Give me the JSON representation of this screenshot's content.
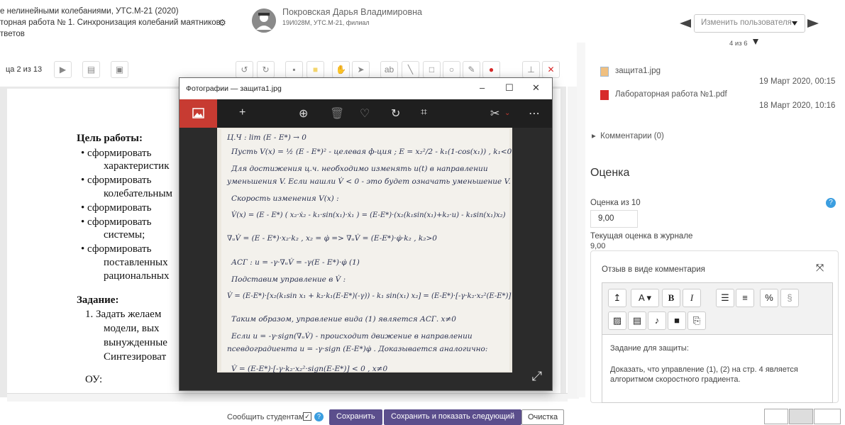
{
  "header": {
    "course_title": "е нелинейными колебаниями, УТС.М-21 (2020)",
    "assignment_title": "торная работа № 1. Синхронизация колебаний маятников",
    "answers_link": "тветов",
    "user_name": "Покровская Дарья Владимировна",
    "user_info": "19И028М, УТС.М-21, филиал",
    "change_user_placeholder": "Изменить пользователя",
    "user_count": "4 из 6"
  },
  "pdf_toolbar": {
    "page_label": "ца 2 из 13"
  },
  "document": {
    "lines": [
      "Цель работы:",
      "•  сформировать",
      "характеристик",
      "•  сформировать",
      "колебательным",
      "•  сформировать",
      "•  сформировать",
      "системы;",
      "•  сформировать",
      "поставленных",
      "рациональных",
      "Задание:",
      "1.  Задать желаем",
      "модели,  вых",
      "вынужденные",
      "Синтезироват",
      "ОУ:"
    ]
  },
  "photo_window": {
    "title": "Фотографии — защита1.jpg",
    "handwriting": [
      "Ц.Ч :  lim (E - E*) → 0",
      "Пусть  V(x) = ½ (E - E*)²  - целевая ф-ция ;  E = x₂²/2 - k₁(1-cos(x₁)) , k₁<0",
      "Для достижения ц.ч. необходимо изменять u(t) в направлении",
      "уменьшения V.  Если нашли V̇ < 0 - это будет означать уменьшение V.",
      "Скорость изменения V(x) :",
      "V̇(x) = (E - E*) ( x₂·ẋ₂ - k₁·sin(x₁)·ẋ₁ ) = (E-E*)·(x₂(k₁sin(x₁)+k₂·u) - k₁sin(x₁)x₂)",
      "∇ᵤV̇ = (E - E*)·x₂·k₂ ,   x₂ = φ̇   =>  ∇ᵤV̇ = (E-E*)·φ̇·k₂ , k₂>0",
      "АСГ :  u = -γ·∇ᵤV̇ = -γ(E - E*)·φ̇          (1)",
      "Подставим управление в V̇ :",
      "V̇ = (E-E*)·[x₂(k₁sin x₁ + k₂·k₁(E-E*)(-γ)) - k₁ sin(x₁) x₂] = (E-E*)·[-γ·k₂·x₂²(E-E*)] < 0",
      "Таким образом, управление вида (1) является АСГ.     x≠0",
      "Если u = -γ·sign(∇ᵤV̇) - происходит движение в направлении",
      "псевдоградиента      u = -γ·sign (E-E*)φ̇ . Доказывается аналогично:",
      "V̇ = (E-E*)·[-γ·k₂·x₂²·sign(E-E*)] < 0 ,   x≠0"
    ]
  },
  "files": [
    {
      "name": "защита1.jpg",
      "date": "19 Март 2020, 00:15"
    },
    {
      "name": "Лабораторная работа №1.pdf",
      "date": "18 Март 2020, 10:16"
    }
  ],
  "comments_toggle": "Комментарии (0)",
  "grading": {
    "heading": "Оценка",
    "grade_label": "Оценка из 10",
    "grade_value": "9,00",
    "current_label": "Текущая оценка в журнале",
    "current_value": "9,00"
  },
  "feedback": {
    "title": "Отзыв в виде комментария",
    "text1": "Задание для защиты:",
    "text2": "Доказать, что управление (1), (2) на стр. 4 является",
    "text3": "алгоритмом скоростного градиента."
  },
  "bottom": {
    "notify_label": "Сообщить студентам",
    "save": "Сохранить",
    "save_next": "Сохранить и показать следующий",
    "reset": "Очистка"
  },
  "colors": {
    "primary_button": "#5b4e8c",
    "photos_accent": "#c73b32",
    "help_blue": "#3b9ee0"
  }
}
